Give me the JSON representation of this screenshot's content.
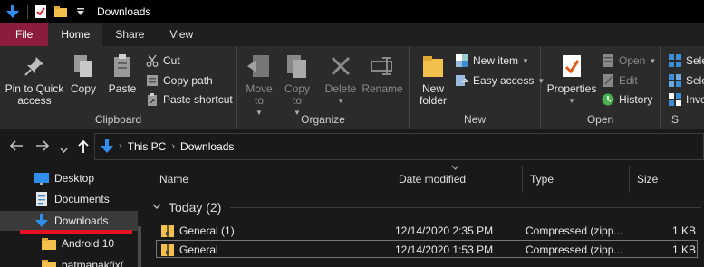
{
  "titlebar": {
    "title": "Downloads"
  },
  "tabs": [
    "File",
    "Home",
    "Share",
    "View"
  ],
  "ribbon": {
    "clipboard": {
      "label": "Clipboard",
      "pin": "Pin to Quick access",
      "copy": "Copy",
      "paste": "Paste",
      "cut": "Cut",
      "copy_path": "Copy path",
      "paste_shortcut": "Paste shortcut"
    },
    "organize": {
      "label": "Organize",
      "move_to": "Move to",
      "copy_to": "Copy to",
      "delete": "Delete",
      "rename": "Rename"
    },
    "new": {
      "label": "New",
      "new_folder": "New folder",
      "new_item": "New item",
      "easy_access": "Easy access"
    },
    "open": {
      "label": "Open",
      "properties": "Properties",
      "open": "Open",
      "edit": "Edit",
      "history": "History"
    },
    "select": {
      "label": "S",
      "items": [
        "Sele",
        "Sele",
        "Inve"
      ]
    }
  },
  "address": {
    "crumbs": [
      "This PC",
      "Downloads"
    ]
  },
  "sidebar": {
    "items": [
      {
        "label": "Desktop",
        "icon": "desktop-icon"
      },
      {
        "label": "Documents",
        "icon": "documents-icon"
      },
      {
        "label": "Downloads",
        "icon": "download-arrow-icon"
      },
      {
        "label": "Android 10",
        "icon": "folder-icon"
      },
      {
        "label": "batmanakfix(",
        "icon": "folder-icon"
      }
    ]
  },
  "filelist": {
    "columns": [
      "Name",
      "Date modified",
      "Type",
      "Size"
    ],
    "group": "Today (2)",
    "rows": [
      {
        "name": "General (1)",
        "date": "12/14/2020 2:35 PM",
        "type": "Compressed (zipp...",
        "size": "1 KB"
      },
      {
        "name": "General",
        "date": "12/14/2020 1:53 PM",
        "type": "Compressed (zipp...",
        "size": "1 KB"
      }
    ]
  },
  "colors": {
    "file_tab": "#8c1c3c",
    "accent_blue": "#2e8ff0",
    "annotation_red": "#e81123",
    "folder_yellow": "#f3c14b"
  }
}
